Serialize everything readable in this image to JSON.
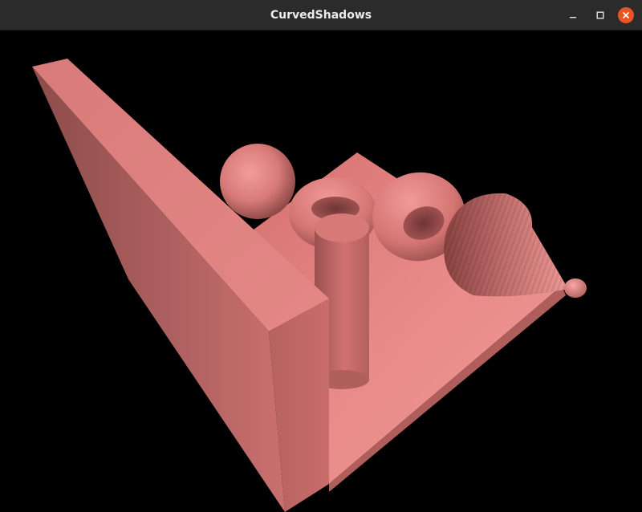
{
  "window": {
    "title": "CurvedShadows",
    "controls": {
      "minimize_icon": "minimize-icon",
      "maximize_icon": "maximize-icon",
      "close_icon": "close-icon"
    },
    "colors": {
      "titlebar": "#2b2b2b",
      "title_text": "#ececec",
      "close_button": "#e95420",
      "background": "#000000"
    }
  },
  "scene": {
    "objects": [
      "wall",
      "floor",
      "sphere",
      "torus",
      "torus",
      "cylinder",
      "cone",
      "small-sphere"
    ],
    "material_color": "#e88a88"
  }
}
